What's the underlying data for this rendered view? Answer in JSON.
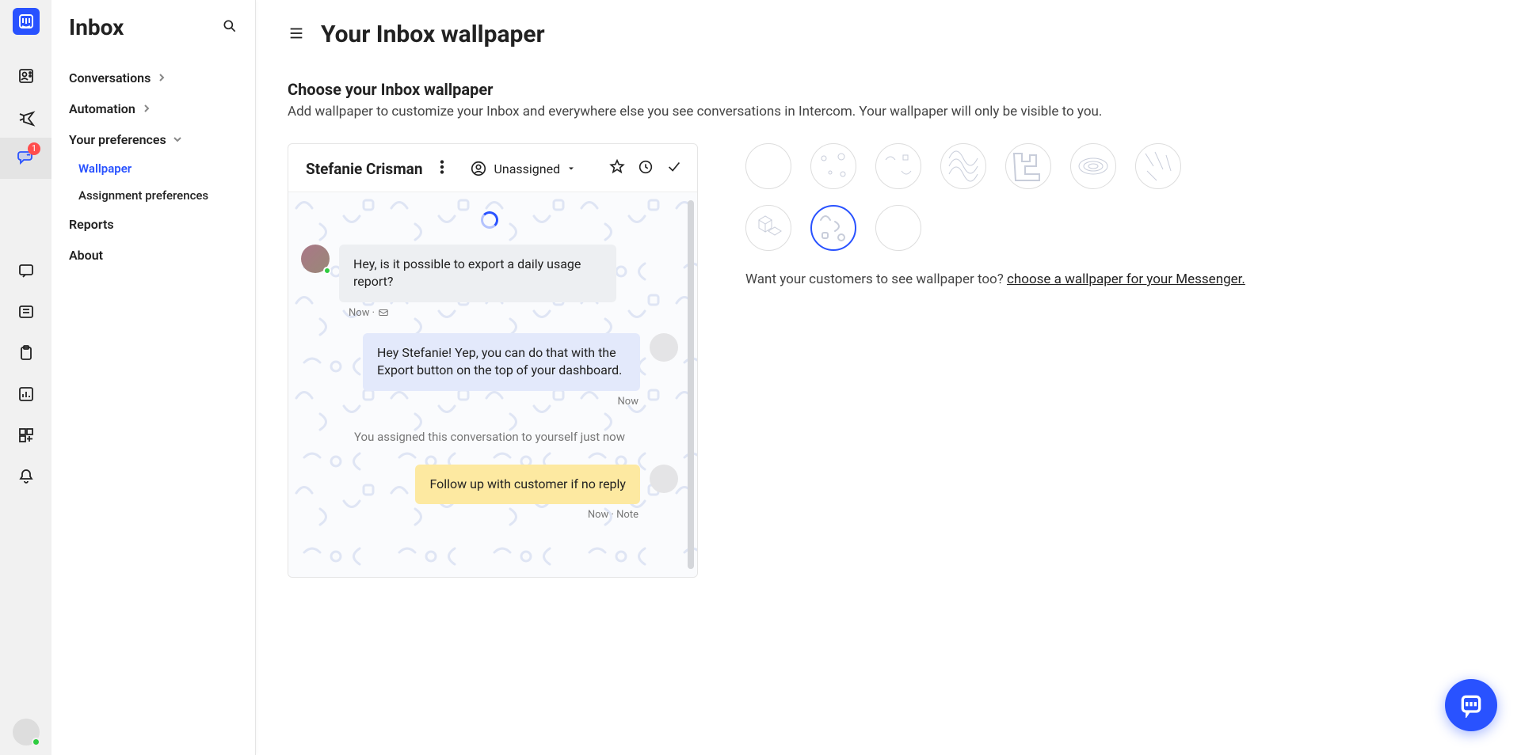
{
  "rail": {
    "badges": {
      "conversations": 1
    }
  },
  "panel": {
    "title": "Inbox",
    "nav": [
      {
        "label": "Conversations",
        "expandable": true
      },
      {
        "label": "Automation",
        "expandable": true
      },
      {
        "label": "Your preferences",
        "expandable": true,
        "open": true,
        "children": [
          {
            "label": "Wallpaper",
            "active": true
          },
          {
            "label": "Assignment preferences"
          }
        ]
      },
      {
        "label": "Reports"
      },
      {
        "label": "About"
      }
    ]
  },
  "header": {
    "title": "Your Inbox wallpaper"
  },
  "section": {
    "title": "Choose your Inbox wallpaper",
    "subtitle": "Add wallpaper to customize your Inbox and everywhere else you see conversations in Intercom. Your wallpaper will only be visible to you."
  },
  "preview": {
    "name": "Stefanie Crisman",
    "assignee": "Unassigned",
    "messages": {
      "in": {
        "text": "Hey, is it possible to export a daily usage report?",
        "meta": "Now ·"
      },
      "out": {
        "text": "Hey Stefanie! Yep, you can do that with the Export button on the top of your dashboard.",
        "meta": "Now"
      },
      "system": "You assigned this conversation to yourself just now",
      "note": {
        "text": "Follow up with customer if no reply",
        "meta": "Now · Note"
      }
    }
  },
  "picker": {
    "footer_text": "Want your customers to see wallpaper too? ",
    "footer_link": "choose a wallpaper for your Messenger."
  }
}
